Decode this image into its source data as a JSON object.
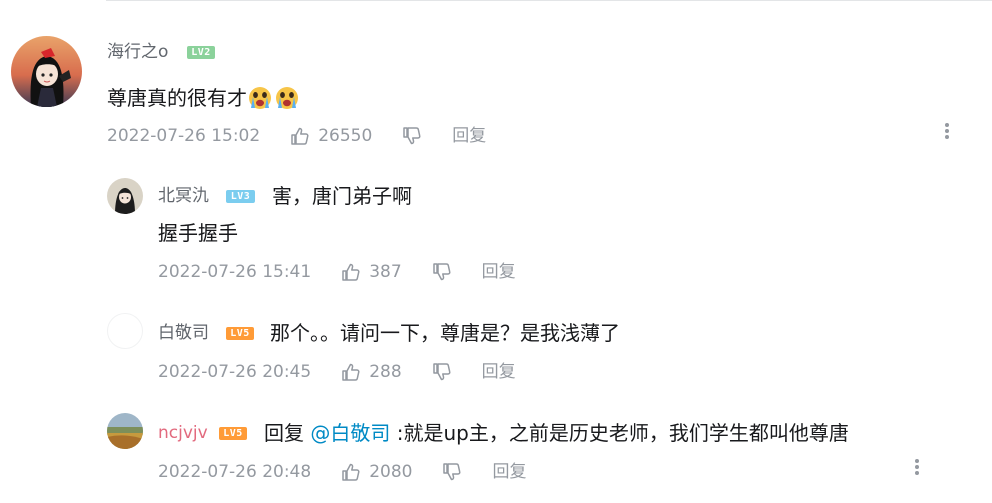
{
  "main_comment": {
    "username": "海行之o",
    "level": "LV2",
    "text": "尊唐真的很有才",
    "emoji_icons": [
      "crying-face-icon",
      "crying-face-icon"
    ],
    "date": "2022-07-26 15:02",
    "likes": "26550",
    "reply_label": "回复"
  },
  "replies": [
    {
      "username": "北冥氿",
      "level": "LV3",
      "text_line1": "害，唐门弟子啊",
      "text_line2": "握手握手",
      "date": "2022-07-26 15:41",
      "likes": "387",
      "reply_label": "回复"
    },
    {
      "username": "白敬司",
      "level": "LV5",
      "text": "那个。。请问一下，尊唐是？是我浅薄了",
      "date": "2022-07-26 20:45",
      "likes": "288",
      "reply_label": "回复"
    },
    {
      "username": "ncjvjv",
      "level": "LV5",
      "reply_prefix": "回复 ",
      "mention": "@白敬司",
      "text": " :就是up主，之前是历史老师，我们学生都叫他尊唐",
      "date": "2022-07-26 20:48",
      "likes": "2080",
      "reply_label": "回复"
    }
  ],
  "colors": {
    "username": "#61666d",
    "username_highlight": "#e26a7e",
    "mention": "#008ac5",
    "meta": "#9499a0",
    "lv2": "#8bd29b",
    "lv3": "#7bcdef",
    "lv5": "#ff9b37"
  }
}
